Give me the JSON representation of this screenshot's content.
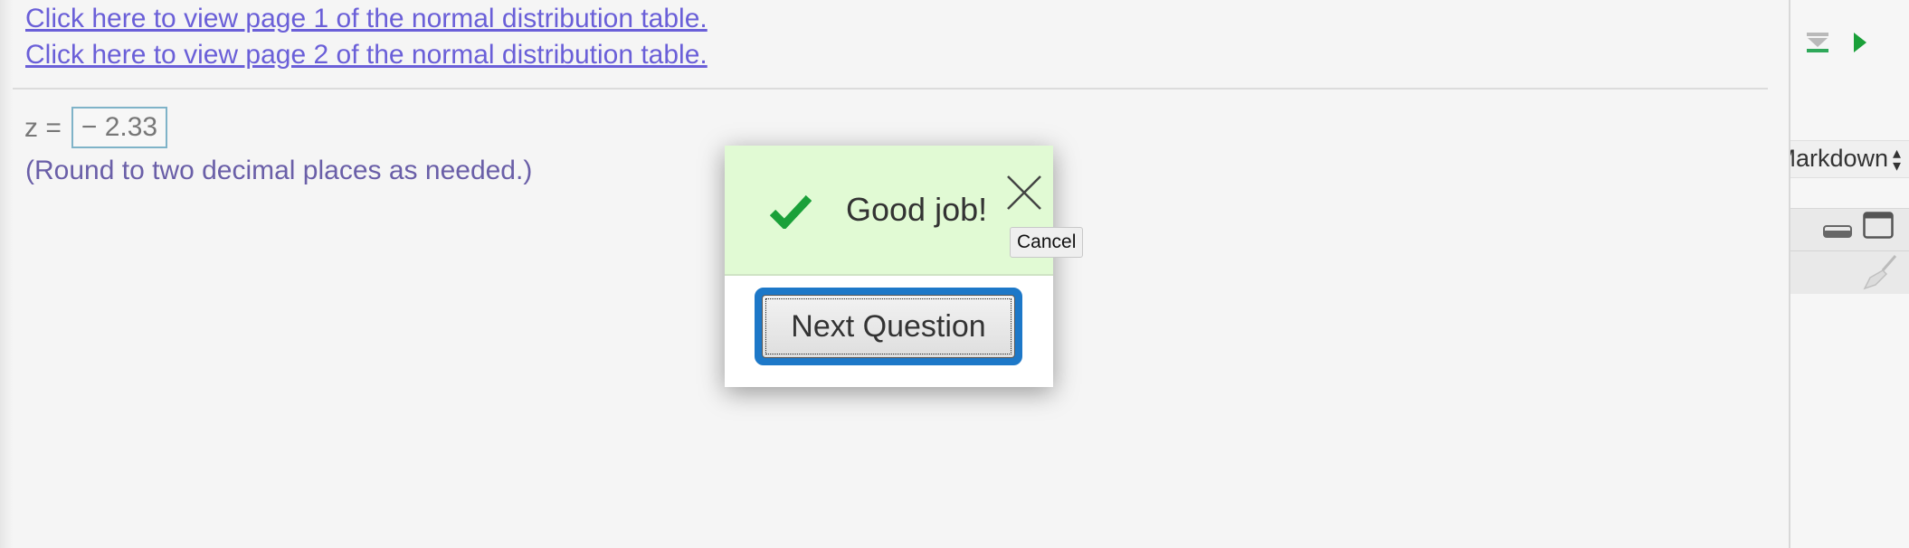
{
  "links": {
    "page1": "Click here to view page 1 of the normal distribution table.",
    "page2": "Click here to view page 2 of the normal distribution table."
  },
  "question": {
    "z_label": "z =",
    "answer_value": "− 2.33",
    "hint": "(Round to two decimal places as needed.)"
  },
  "feedback_popup": {
    "message": "Good job!",
    "next_button_label": "Next Question",
    "close_tooltip": "Cancel",
    "icons": {
      "status": "checkmark-icon",
      "close": "close-icon"
    },
    "colors": {
      "success_bg": "#e1fad4",
      "check": "#1aa039",
      "focus_ring": "#1d78c8"
    }
  },
  "right_panel": {
    "cell_type_select": "Markdown",
    "icons": [
      "download-icon",
      "run-icon",
      "minimize-icon",
      "maximize-icon",
      "clear-output-icon"
    ]
  },
  "colors": {
    "link": "#6a5fd8",
    "hint": "#6a5fa8",
    "background": "#f5f5f5"
  }
}
